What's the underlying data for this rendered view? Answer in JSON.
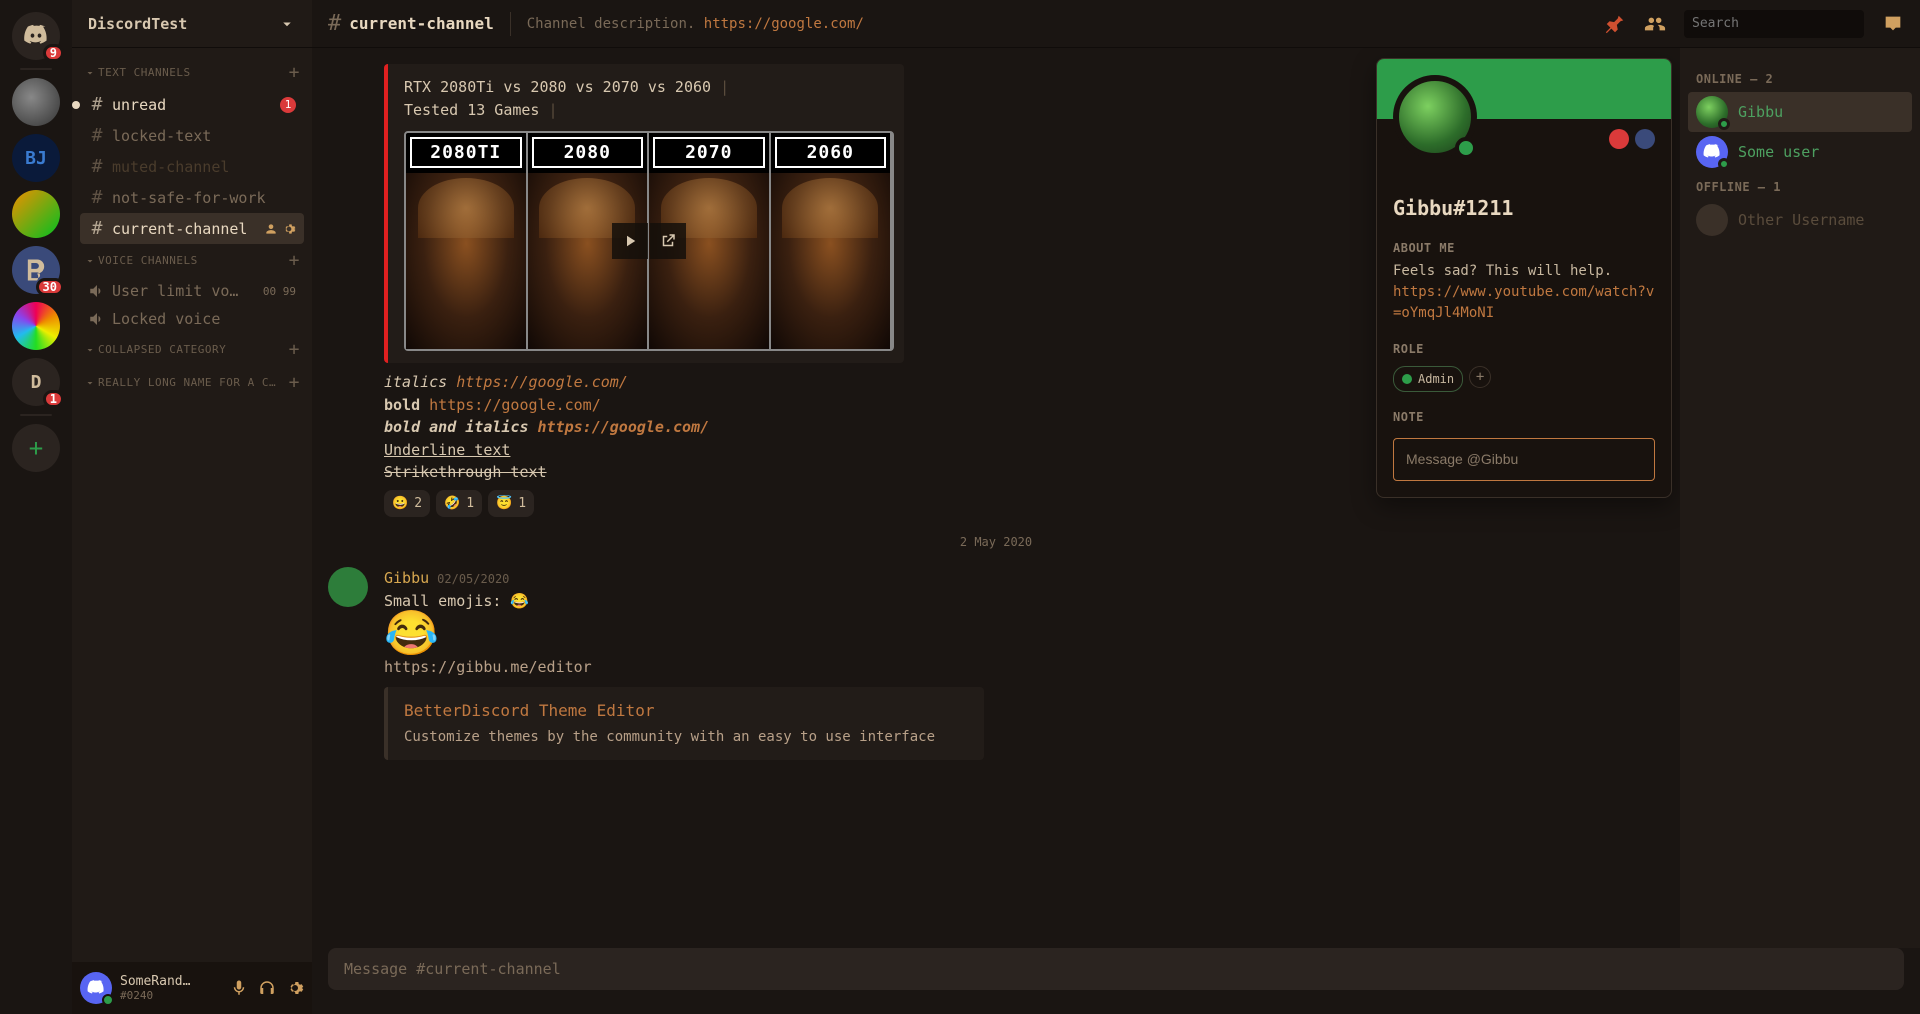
{
  "server_name": "DiscordTest",
  "home_badge": "9",
  "servers": [
    {
      "id": "rl",
      "badge": null
    },
    {
      "id": "bj",
      "letter": "BJ",
      "badge": null
    },
    {
      "id": "ow",
      "badge": null
    },
    {
      "id": "bd",
      "badge": "30"
    },
    {
      "id": "rainbow",
      "badge": null
    },
    {
      "id": "d",
      "letter": "D",
      "badge": "1"
    }
  ],
  "categories": [
    {
      "name": "TEXT CHANNELS",
      "channels": [
        {
          "type": "text",
          "name": "unread",
          "state": "unread",
          "badge": "1"
        },
        {
          "type": "text",
          "name": "locked-text",
          "icon": "lock"
        },
        {
          "type": "text",
          "name": "muted-channel",
          "state": "muted"
        },
        {
          "type": "text",
          "name": "not-safe-for-work"
        },
        {
          "type": "text",
          "name": "current-channel",
          "state": "active",
          "extra": true
        }
      ]
    },
    {
      "name": "VOICE CHANNELS",
      "channels": [
        {
          "type": "voice",
          "name": "User limit vo…",
          "count": "00 99"
        },
        {
          "type": "voice",
          "name": "Locked voice",
          "icon": "lock"
        }
      ]
    },
    {
      "name": "COLLAPSED CATEGORY",
      "channels": []
    },
    {
      "name": "REALLY LONG NAME FOR A C…",
      "channels": []
    }
  ],
  "user_panel": {
    "name": "SomeRand…",
    "tag": "#0240"
  },
  "topbar": {
    "channel": "current-channel",
    "desc": "Channel description.",
    "link": "https://google.com/",
    "search_placeholder": "Search"
  },
  "embed1": {
    "line1": "RTX 2080Ti vs 2080 vs 2070 vs 2060",
    "line2": "Tested 13 Games",
    "labels": [
      "2080TI",
      "2080",
      "2070",
      "2060"
    ]
  },
  "text_samples": {
    "italics": "italics",
    "italics_link": "https://google.com/",
    "bold": "bold",
    "bold_link": "https://google.com/",
    "bi": "bold and italics",
    "bi_link": "https://google.com/",
    "under": "Underline text",
    "strike": "Strikethrough text"
  },
  "reactions": [
    {
      "e": "😀",
      "c": "2"
    },
    {
      "e": "🤣",
      "c": "1"
    },
    {
      "e": "😇",
      "c": "1"
    }
  ],
  "date_divider": "2 May 2020",
  "msg2": {
    "author": "Gibbu",
    "time": "02/05/2020",
    "small": "Small emojis:",
    "link": "https://gibbu.me/editor"
  },
  "embed2": {
    "title": "BetterDiscord Theme Editor",
    "desc": "Customize themes by the community with an easy to use interface"
  },
  "input_placeholder": "Message #current-channel",
  "profile": {
    "name": "Gibbu#1211",
    "about_label": "ABOUT ME",
    "about": "Feels sad? This will help.",
    "about_link": "https://www.youtube.com/watch?v=oYmqJl4MoNI",
    "role_label": "ROLE",
    "role": "Admin",
    "note_label": "NOTE",
    "msg_placeholder": "Message @Gibbu"
  },
  "members": {
    "online_label": "ONLINE — 2",
    "offline_label": "OFFLINE — 1",
    "online": [
      {
        "name": "Gibbu",
        "color": "#4da060",
        "sel": true,
        "av": "pepe"
      },
      {
        "name": "Some user",
        "color": "#4da060",
        "av": "discord"
      }
    ],
    "offline": [
      {
        "name": "Other Username"
      }
    ]
  }
}
